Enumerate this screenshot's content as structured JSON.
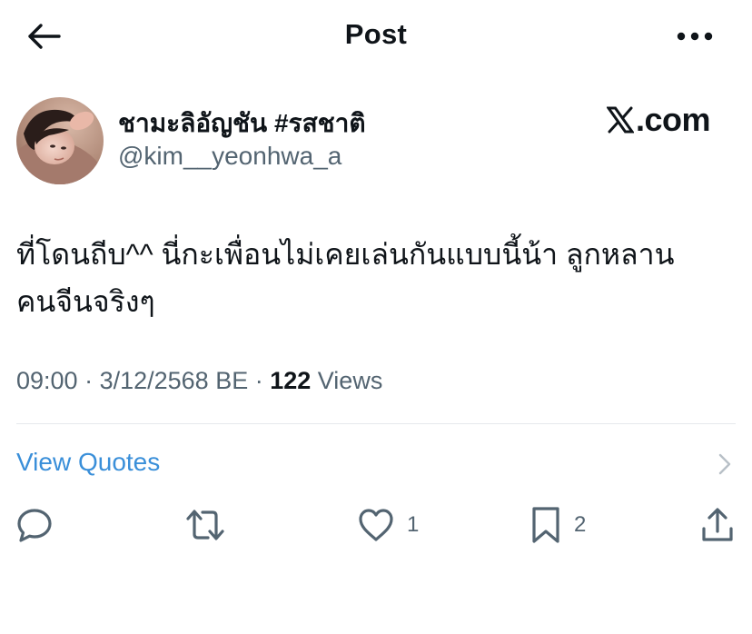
{
  "header": {
    "title": "Post",
    "back_icon": "arrow-left-icon",
    "more_icon": "more-horizontal-icon"
  },
  "author": {
    "display_name": "ชามะลิอัญชัน #รสชาติ",
    "handle": "@kim__yeonhwa_a",
    "avatar_icon": "avatar-photo"
  },
  "brand": {
    "logo": "X",
    "domain": ".com"
  },
  "post": {
    "text_line1": "ที่โดนถีบ^^ นี่กะเพื่อนไม่เคยเล่นกันแบบนี้น้า ลูกหลาน",
    "text_line2": "คนจีนจริงๆ"
  },
  "meta": {
    "time": "09:00",
    "sep1": " · ",
    "date": "3/12/2568 BE",
    "sep2": " · ",
    "views_count": "122",
    "views_label": " Views"
  },
  "quotes": {
    "label": "View Quotes"
  },
  "actions": {
    "reply": {
      "icon": "reply-icon",
      "count": ""
    },
    "repost": {
      "icon": "repost-icon",
      "count": ""
    },
    "like": {
      "icon": "heart-icon",
      "count": "1"
    },
    "bookmark": {
      "icon": "bookmark-icon",
      "count": "2"
    },
    "share": {
      "icon": "share-icon"
    }
  },
  "colors": {
    "text": "#0f1419",
    "secondary": "#536471",
    "link": "#3a8fd9",
    "divider": "#e6e9ec"
  }
}
